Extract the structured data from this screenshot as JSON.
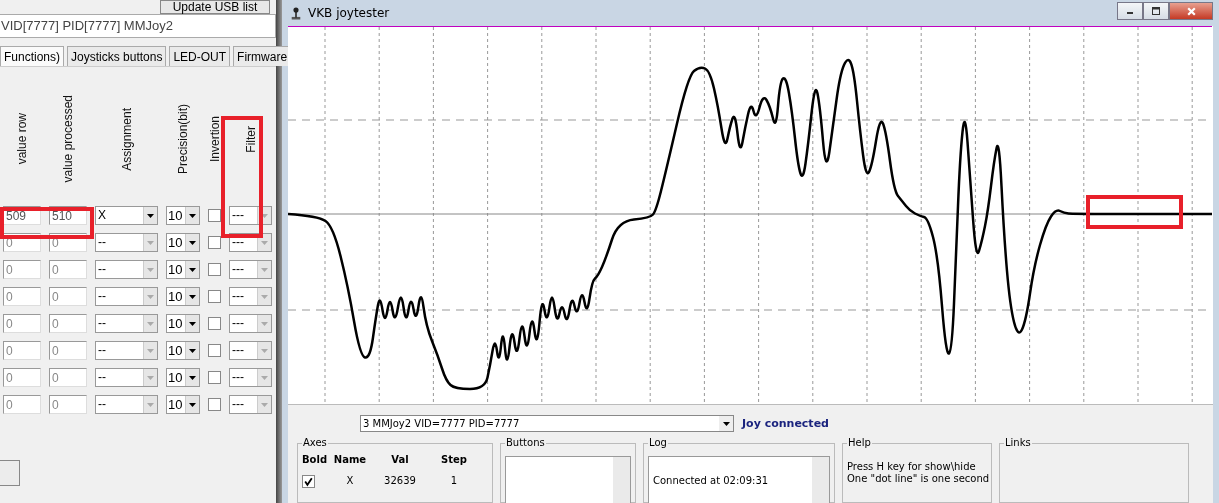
{
  "config_window": {
    "update_button": "Update USB list",
    "device_field": "VID[7777] PID[7777] MMJoy2",
    "tabs": [
      {
        "label": "Functions)",
        "selected": true
      },
      {
        "label": "Joysticks buttons",
        "selected": false
      },
      {
        "label": "LED-OUT",
        "selected": false
      },
      {
        "label": "Firmware",
        "selected": false
      }
    ],
    "columns": [
      "value row",
      "value processed",
      "Assignment",
      "Precision(bit)",
      "Invertion",
      "Filter"
    ],
    "rows": [
      {
        "value_row": "509",
        "value_processed": "510",
        "assignment": "X",
        "precision": "10",
        "invertion": false,
        "filter": "---",
        "enabled": true
      },
      {
        "value_row": "0",
        "value_processed": "0",
        "assignment": "--",
        "precision": "10",
        "invertion": false,
        "filter": "---",
        "enabled": false
      },
      {
        "value_row": "0",
        "value_processed": "0",
        "assignment": "--",
        "precision": "10",
        "invertion": false,
        "filter": "---",
        "enabled": false
      },
      {
        "value_row": "0",
        "value_processed": "0",
        "assignment": "--",
        "precision": "10",
        "invertion": false,
        "filter": "---",
        "enabled": false
      },
      {
        "value_row": "0",
        "value_processed": "0",
        "assignment": "--",
        "precision": "10",
        "invertion": false,
        "filter": "---",
        "enabled": false
      },
      {
        "value_row": "0",
        "value_processed": "0",
        "assignment": "--",
        "precision": "10",
        "invertion": false,
        "filter": "---",
        "enabled": false
      },
      {
        "value_row": "0",
        "value_processed": "0",
        "assignment": "--",
        "precision": "10",
        "invertion": false,
        "filter": "---",
        "enabled": false
      },
      {
        "value_row": "0",
        "value_processed": "0",
        "assignment": "--",
        "precision": "10",
        "invertion": false,
        "filter": "---",
        "enabled": false
      }
    ]
  },
  "joytester": {
    "title": "VKB joytester",
    "device_select": "3 MMJoy2 VID=7777 PID=7777",
    "status": "Joy connected",
    "axes": {
      "title": "Axes",
      "columns": [
        "Bold",
        "Name",
        "Val",
        "Step"
      ],
      "rows": [
        {
          "bold": true,
          "name": "X",
          "val": "32639",
          "step": "1"
        }
      ]
    },
    "buttons_group": {
      "title": "Buttons"
    },
    "log": {
      "title": "Log",
      "lines": [
        "Connected at 02:09:31"
      ]
    },
    "help": {
      "title": "Help",
      "lines": [
        "Press H key for show\\hide",
        "One \"dot line\" is one second"
      ]
    },
    "links": {
      "title": "Links"
    }
  }
}
